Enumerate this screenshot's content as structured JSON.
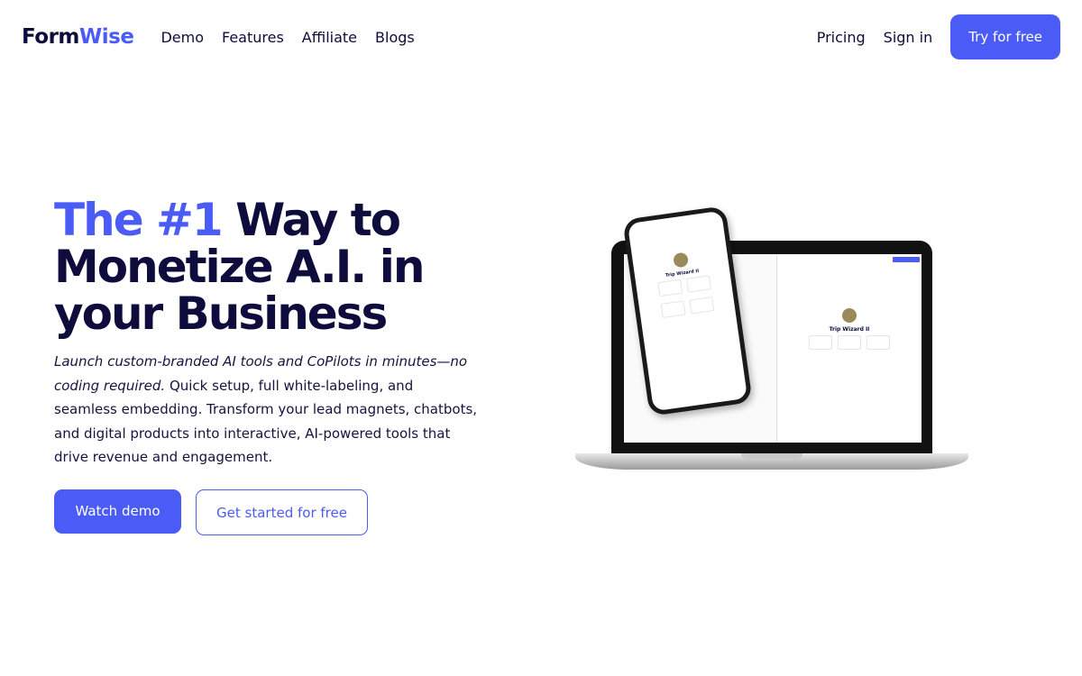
{
  "nav": {
    "logo_a": "Form",
    "logo_b": "Wise",
    "links": [
      "Demo",
      "Features",
      "Affiliate",
      "Blogs"
    ],
    "pricing": "Pricing",
    "signin": "Sign in",
    "try": "Try for free"
  },
  "hero": {
    "title_hl": "The #1",
    "title_rest": " Way to Monetize A.I. in your Business",
    "desc_italic": "Launch custom-branded AI tools and CoPilots in minutes—no coding required.",
    "desc_rest": " Quick setup, full white-labeling, and seamless embedding. Transform your lead magnets, chatbots, and digital products into interactive, AI-powered tools that drive revenue and engagement.",
    "watch": "Watch demo",
    "started": "Get started for free"
  },
  "mockup": {
    "laptop_title": "Trip Wizard II",
    "phone_title": "Trip Wizard II"
  },
  "colors": {
    "accent": "#4a5cf5",
    "text": "#0d0c3c"
  }
}
